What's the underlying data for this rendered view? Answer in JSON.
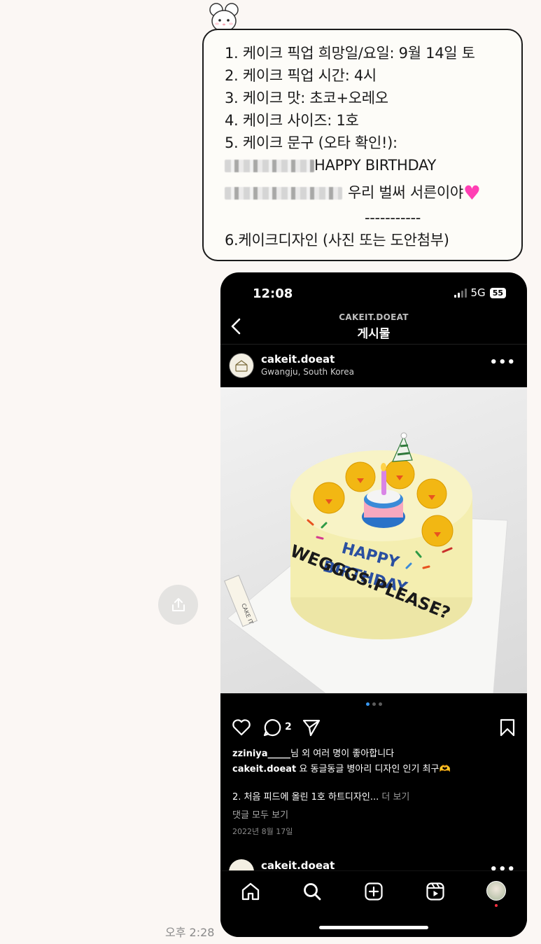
{
  "chat": {
    "order_lines": [
      "1. 케이크 픽업 희망일/요일: 9월 14일 토",
      "2. 케이크 픽업 시간: 4시",
      "3. 케이크 맛: 초코+오레오",
      "4. 케이크 사이즈: 1호",
      "5. 케이크 문구 (오타 확인!):"
    ],
    "cake_text_line1": "HAPPY BIRTHDAY",
    "cake_text_line2": "우리 벌써 서른이야",
    "separator": "-----------",
    "design_line": "6.케이크디자인 (사진 또는 도안첨부)",
    "timestamp": "오후 2:28"
  },
  "phone": {
    "status": {
      "time": "12:08",
      "network": "5G",
      "battery": "55"
    },
    "header": {
      "account_caps": "CAKEIT.DOEAT",
      "title": "게시물"
    },
    "post": {
      "username": "cakeit.doeat",
      "location": "Gwangju, South Korea",
      "photo_text": {
        "line1": "HAPPY",
        "line2": "BIRTHDAY",
        "side": "WEGGGS.PLEASE?",
        "tag": "CAKE IT"
      },
      "comment_count": "2",
      "likes_user": "zziniya_____",
      "likes_text": "님 외 여러 명이 좋아합니다",
      "caption_user": "cakeit.doeat",
      "caption_text": "요 동글동글 병아리 디자인 인기 최구🫶",
      "caption_more_text": "2. 처음 피드에 올린 1호 하트디자인...",
      "caption_more_link": "더 보기",
      "view_comments": "댓글 모두 보기",
      "date": "2022년 8월 17일"
    },
    "next_post": {
      "username": "cakeit.doeat"
    }
  },
  "colors": {
    "accent_blue": "#3897f0",
    "heart_pink": "#ff3fb4",
    "cake_yellow": "#f6f0a8"
  }
}
